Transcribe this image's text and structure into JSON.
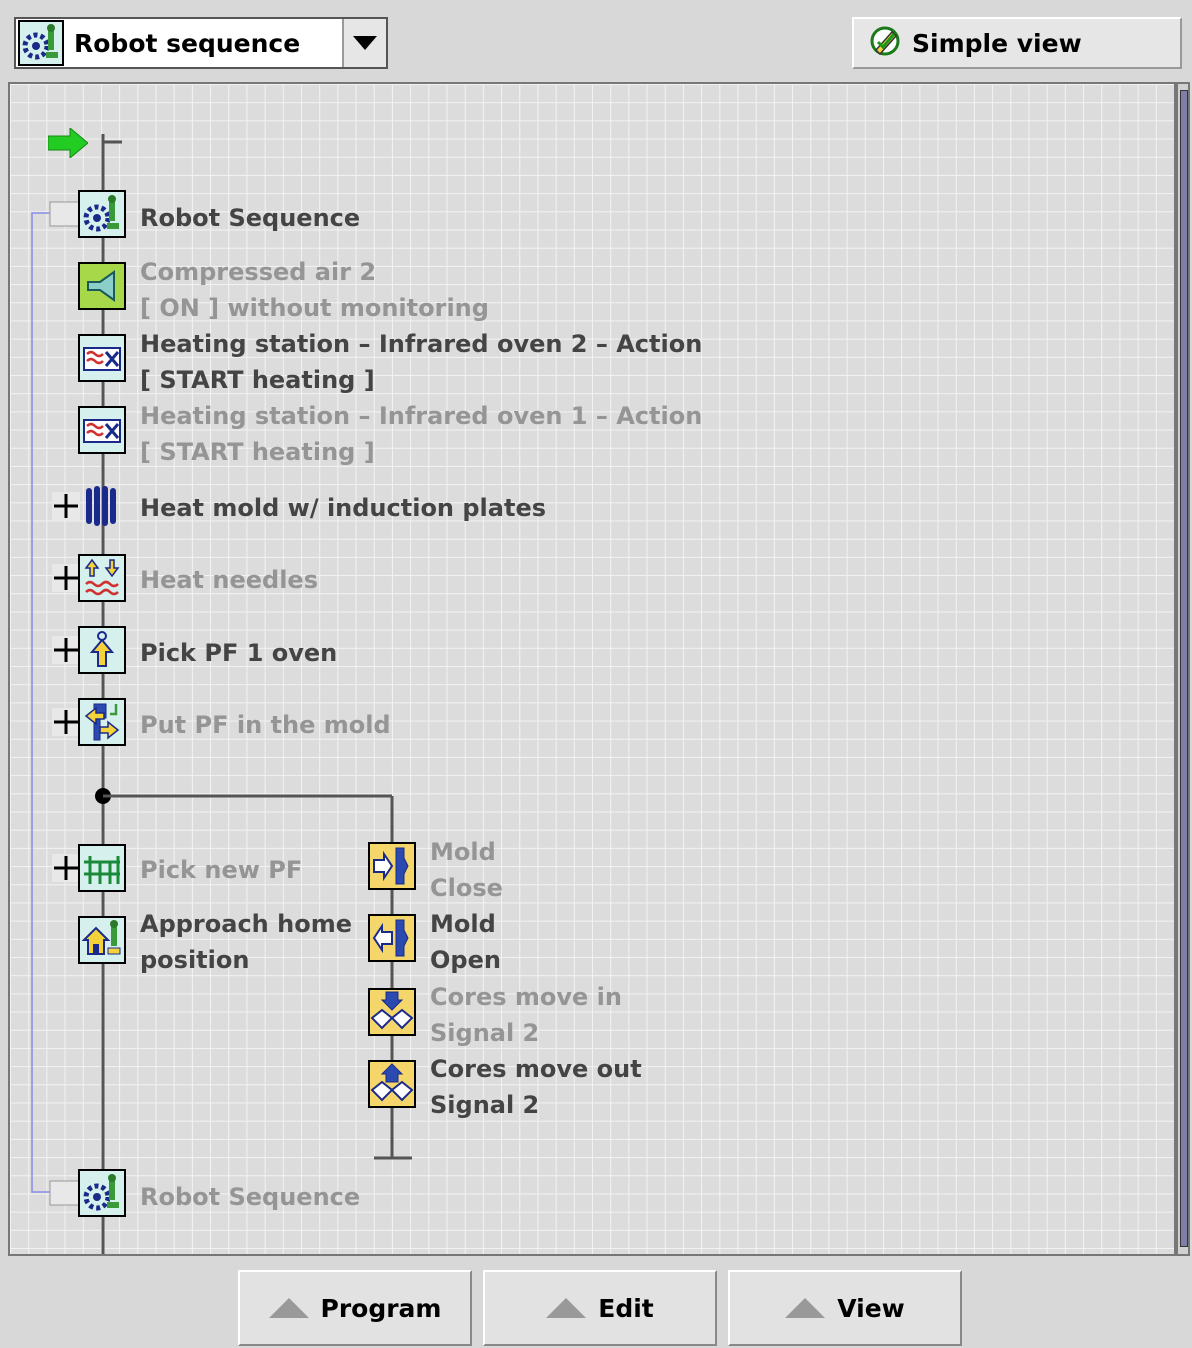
{
  "header": {
    "sequence_select": {
      "value": "Robot sequence",
      "icon": "robot-sequence-icon"
    },
    "simple_view_button": {
      "label": "Simple view",
      "icon": "pencil-check-icon"
    }
  },
  "sequence": {
    "start_marker": "green-arrow-icon",
    "nodes": [
      {
        "id": "robot-seq-start",
        "lines": [
          "Robot Sequence"
        ],
        "state": "active",
        "icon": "robot-sequence-icon"
      },
      {
        "id": "compressed-air-2",
        "lines": [
          "Compressed air 2",
          "[ ON ] without monitoring"
        ],
        "state": "inactive",
        "icon": "compressed-air-icon"
      },
      {
        "id": "infrared-oven-2",
        "lines": [
          "Heating station – Infrared oven 2 – Action",
          "[ START heating ]"
        ],
        "state": "active",
        "icon": "infrared-oven-icon"
      },
      {
        "id": "infrared-oven-1",
        "lines": [
          "Heating station – Infrared oven 1 – Action",
          "[ START heating ]"
        ],
        "state": "inactive",
        "icon": "infrared-oven-icon"
      },
      {
        "id": "heat-mold",
        "lines": [
          "Heat mold w/ induction plates"
        ],
        "state": "active",
        "icon": "induction-plates-icon",
        "expandable": true
      },
      {
        "id": "heat-needles",
        "lines": [
          "Heat needles"
        ],
        "state": "inactive",
        "icon": "heat-needles-icon",
        "expandable": true
      },
      {
        "id": "pick-pf-1",
        "lines": [
          "Pick PF 1 oven"
        ],
        "state": "active",
        "icon": "pick-arrow-icon",
        "expandable": true
      },
      {
        "id": "put-pf-mold",
        "lines": [
          "Put PF in the mold"
        ],
        "state": "inactive",
        "icon": "put-in-mold-icon",
        "expandable": true
      },
      {
        "id": "pick-new-pf",
        "lines": [
          "Pick new PF"
        ],
        "state": "inactive",
        "icon": "pick-new-pf-icon",
        "expandable": true
      },
      {
        "id": "approach-home",
        "lines": [
          "Approach home",
          "position"
        ],
        "state": "active",
        "icon": "home-position-icon"
      },
      {
        "id": "mold-close",
        "lines": [
          "Mold",
          "Close"
        ],
        "state": "inactive",
        "icon": "mold-close-icon"
      },
      {
        "id": "mold-open",
        "lines": [
          "Mold",
          "Open"
        ],
        "state": "active",
        "icon": "mold-open-icon"
      },
      {
        "id": "cores-in",
        "lines": [
          "Cores move in",
          "Signal 2"
        ],
        "state": "inactive",
        "icon": "cores-in-icon"
      },
      {
        "id": "cores-out",
        "lines": [
          "Cores move out",
          "Signal 2"
        ],
        "state": "active",
        "icon": "cores-out-icon"
      },
      {
        "id": "robot-seq-end",
        "lines": [
          "Robot Sequence"
        ],
        "state": "inactive",
        "icon": "robot-sequence-icon"
      }
    ]
  },
  "footer": {
    "buttons": [
      {
        "label": "Program"
      },
      {
        "label": "Edit"
      },
      {
        "label": "View"
      }
    ]
  },
  "colors": {
    "active_text": "#444444",
    "inactive_text": "#959595",
    "grid_bg": "#dcdcdc",
    "loop_line": "#8a8ae6",
    "start_arrow": "#22cc22",
    "mold_icon_bg": "#f5d66a"
  }
}
